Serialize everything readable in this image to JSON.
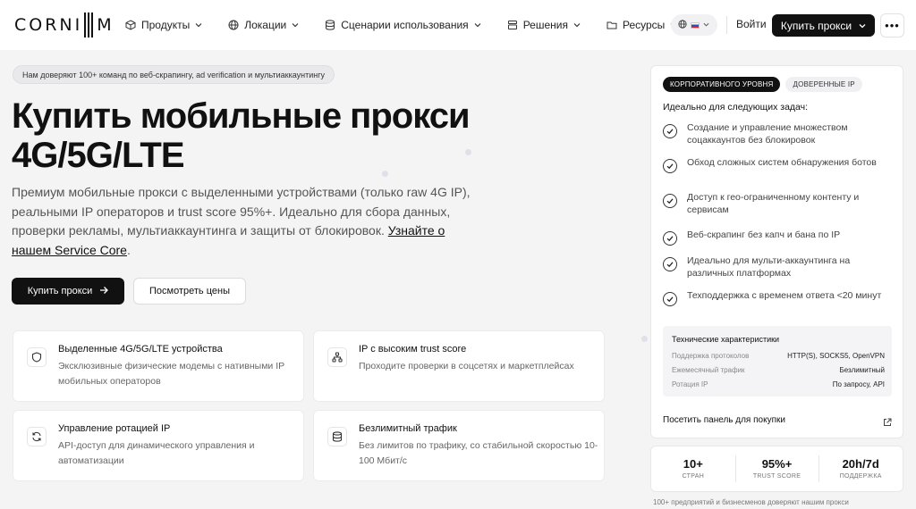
{
  "nav": {
    "logo_text": "CORNI",
    "logo_suffix": "M",
    "items": [
      {
        "label": "Продукты",
        "icon": "cube-icon"
      },
      {
        "label": "Локации",
        "icon": "globe-icon"
      },
      {
        "label": "Сценарии использования",
        "icon": "database-icon"
      },
      {
        "label": "Решения",
        "icon": "layers-icon"
      },
      {
        "label": "Ресурсы",
        "icon": "folder-icon"
      }
    ],
    "login": "Войти",
    "buy": "Купить прокси",
    "more": "•••"
  },
  "hero": {
    "trust_pill": "Нам доверяют 100+ команд по веб-скрапингу, ad verification и мультиаккаунтингу",
    "title_line1": "Купить мобильные прокси",
    "title_line2": "4G/5G/LTE",
    "desc": "Премиум мобильные прокси с выделенными устройствами (только raw 4G IP), реальными IP операторов и trust score 95%+. Идеально для сбора данных, проверки рекламы, мультиаккаунтинга и защиты от блокировок.",
    "desc_link": "Узнайте о нашем Service Core",
    "desc_end": ".",
    "btn_buy": "Купить прокси",
    "btn_prices": "Посмотреть цены"
  },
  "features": [
    {
      "title": "Выделенные 4G/5G/LTE устройства",
      "desc": "Эксклюзивные физические модемы с нативными IP мобильных операторов",
      "icon": "shield-icon"
    },
    {
      "title": "IP с высоким trust score",
      "desc": "Проходите проверки в соцсетях и маркетплейсах",
      "icon": "network-icon"
    },
    {
      "title": "Управление ротацией IP",
      "desc": "API-доступ для динамического управления и автоматизации",
      "icon": "refresh-icon"
    },
    {
      "title": "Безлимитный трафик",
      "desc": "Без лимитов по трафику, со стабильной скоростью 10-100 Мбит/с",
      "icon": "database-icon"
    }
  ],
  "panel": {
    "tab_active": "КОРПОРАТИВНОГО УРОВНЯ",
    "tab_inactive": "ДОВЕРЕННЫЕ IP",
    "ideal_title": "Идеально для следующих задач:",
    "uses": [
      "Создание и управление множеством соцаккаунтов без блокировок",
      "Обход сложных систем обнаружения ботов",
      "Доступ к гео-ограниченному контенту и сервисам",
      "Веб-скрапинг без капч и бана по IP",
      "Идеально для мульти-аккаунтинга на различных платформах",
      "Техподдержка с временем ответа <20 минут"
    ],
    "specs": {
      "title": "Технические характеристики",
      "rows": [
        {
          "k": "Поддержка протоколов",
          "v": "HTTP(S), SOCKS5, OpenVPN"
        },
        {
          "k": "Ежемесячный трафик",
          "v": "Безлимитный"
        },
        {
          "k": "Ротация IP",
          "v": "По запросу, API"
        }
      ]
    },
    "visit": "Посетить панель для покупки"
  },
  "stats": [
    {
      "value": "10+",
      "label": "СТРАН"
    },
    {
      "value": "95%+",
      "label": "TRUST SCORE"
    },
    {
      "value": "20h/7d",
      "label": "ПОДДЕРЖКА"
    }
  ],
  "footnote": "100+ предприятий и бизнесменов доверяют нашим прокси"
}
